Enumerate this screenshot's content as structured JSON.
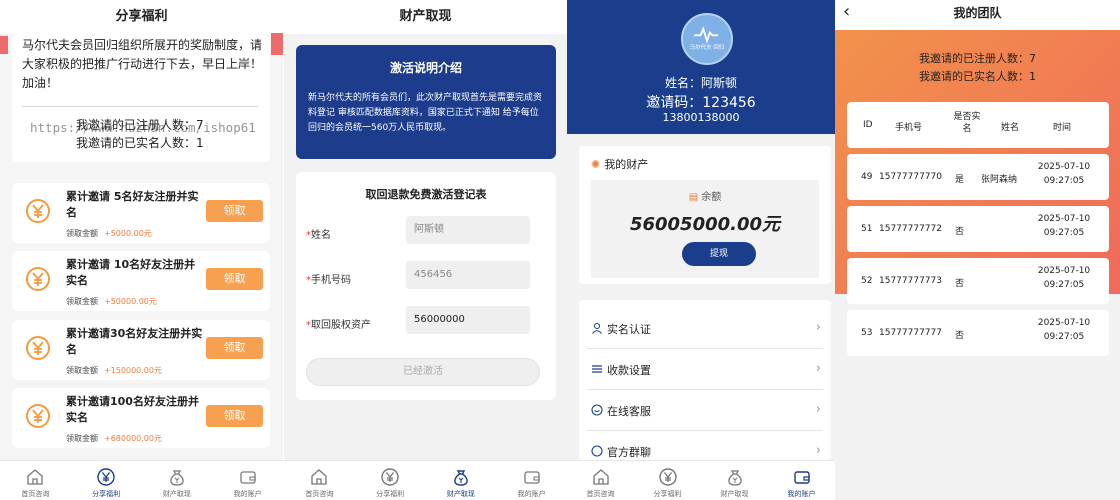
{
  "tabs": [
    {
      "label": "首页咨询",
      "icon": "home-icon"
    },
    {
      "label": "分享福利",
      "icon": "yen-icon"
    },
    {
      "label": "财产取现",
      "icon": "money-bag-icon"
    },
    {
      "label": "我的账户",
      "icon": "wallet-icon"
    }
  ],
  "welfare": {
    "title": "分享福利",
    "intro": "马尔代夫会员回归组织所展开的奖励制度，请大家积极的把推广行动进行下去，早日上岸！加油！",
    "registered": "我邀请的已注册人数：7",
    "verified": "我邀请的已实名人数：1",
    "watermark": "https://www.huzhan.com/ishop61",
    "claim_label": "领取金额",
    "btn": "领取",
    "rewards": [
      {
        "title": "累计邀请 5名好友注册并实名",
        "amount": "+5000.00元"
      },
      {
        "title": "累计邀请 10名好友注册并实名",
        "amount": "+50000.00元"
      },
      {
        "title": "累计邀请30名好友注册并实名",
        "amount": "+150000.00元"
      },
      {
        "title": "累计邀请100名好友注册并实名",
        "amount": "+680000.00元"
      }
    ]
  },
  "withdraw": {
    "title": "财产取现",
    "box_title": "激活说明介绍",
    "box_desc": "新马尔代夫的所有会员们，此次财产取现首先是需要完成资料登记 审核匹配数据库资料，国家已正式下通知 给予每位回归的会员统一560万人民币取现。",
    "form_title": "取回退款免费激活登记表",
    "fields": [
      {
        "label": "姓名",
        "value": "阿斯顿"
      },
      {
        "label": "手机号码",
        "value": "456456"
      },
      {
        "label": "取回股权资产",
        "value": "56000000"
      }
    ],
    "submit": "已经激活"
  },
  "account": {
    "logo_text": "马尔代夫 回归",
    "name": "姓名：阿斯顿",
    "code": "邀请码：123456",
    "phone": "13800138000",
    "asset_title": "我的财产",
    "balance_label": "余额",
    "balance": "56005000.00元",
    "withdraw_btn": "提现",
    "menu": [
      "实名认证",
      "收款设置",
      "在线客服",
      "官方群聊"
    ]
  },
  "team": {
    "title": "我的团队",
    "registered": "我邀请的已注册人数：7",
    "verified": "我邀请的已实名人数：1",
    "headers": [
      "ID",
      "手机号",
      "是否实名",
      "姓名",
      "时间"
    ],
    "rows": [
      {
        "id": "49",
        "phone": "15777777770",
        "real": "是",
        "name": "张阿森纳",
        "date": "2025-07-10",
        "time": "09:27:05"
      },
      {
        "id": "51",
        "phone": "15777777772",
        "real": "否",
        "name": "",
        "date": "2025-07-10",
        "time": "09:27:05"
      },
      {
        "id": "52",
        "phone": "15777777773",
        "real": "否",
        "name": "",
        "date": "2025-07-10",
        "time": "09:27:05"
      },
      {
        "id": "53",
        "phone": "15777777777",
        "real": "否",
        "name": "",
        "date": "2025-07-10",
        "time": "09:27:05"
      }
    ]
  },
  "colors": {
    "brand": "#1a3d8c",
    "accent": "#f7a04f",
    "red": "#ef6a6a"
  }
}
